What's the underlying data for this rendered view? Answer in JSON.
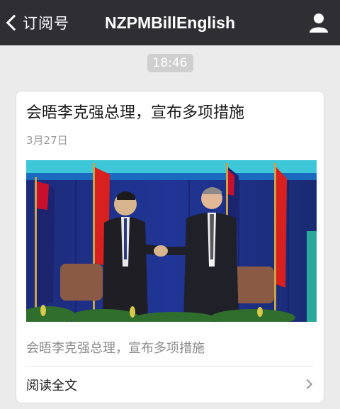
{
  "navbar": {
    "back_label": "订阅号",
    "title": "NZPMBillEnglish"
  },
  "message": {
    "time": "18:46"
  },
  "article": {
    "title": "会晤李克强总理，宣布多项措施",
    "date": "3月27日",
    "summary": "会晤李克强总理，宣布多项措施",
    "read_more": "阅读全文"
  },
  "colors": {
    "navbar_bg": "#2e2e33",
    "page_bg": "#ebebeb",
    "card_bg": "#ffffff",
    "timestamp_bg": "#cfcfcf"
  },
  "icons": {
    "back": "chevron-left-icon",
    "profile": "person-icon",
    "read_more": "chevron-right-icon"
  }
}
